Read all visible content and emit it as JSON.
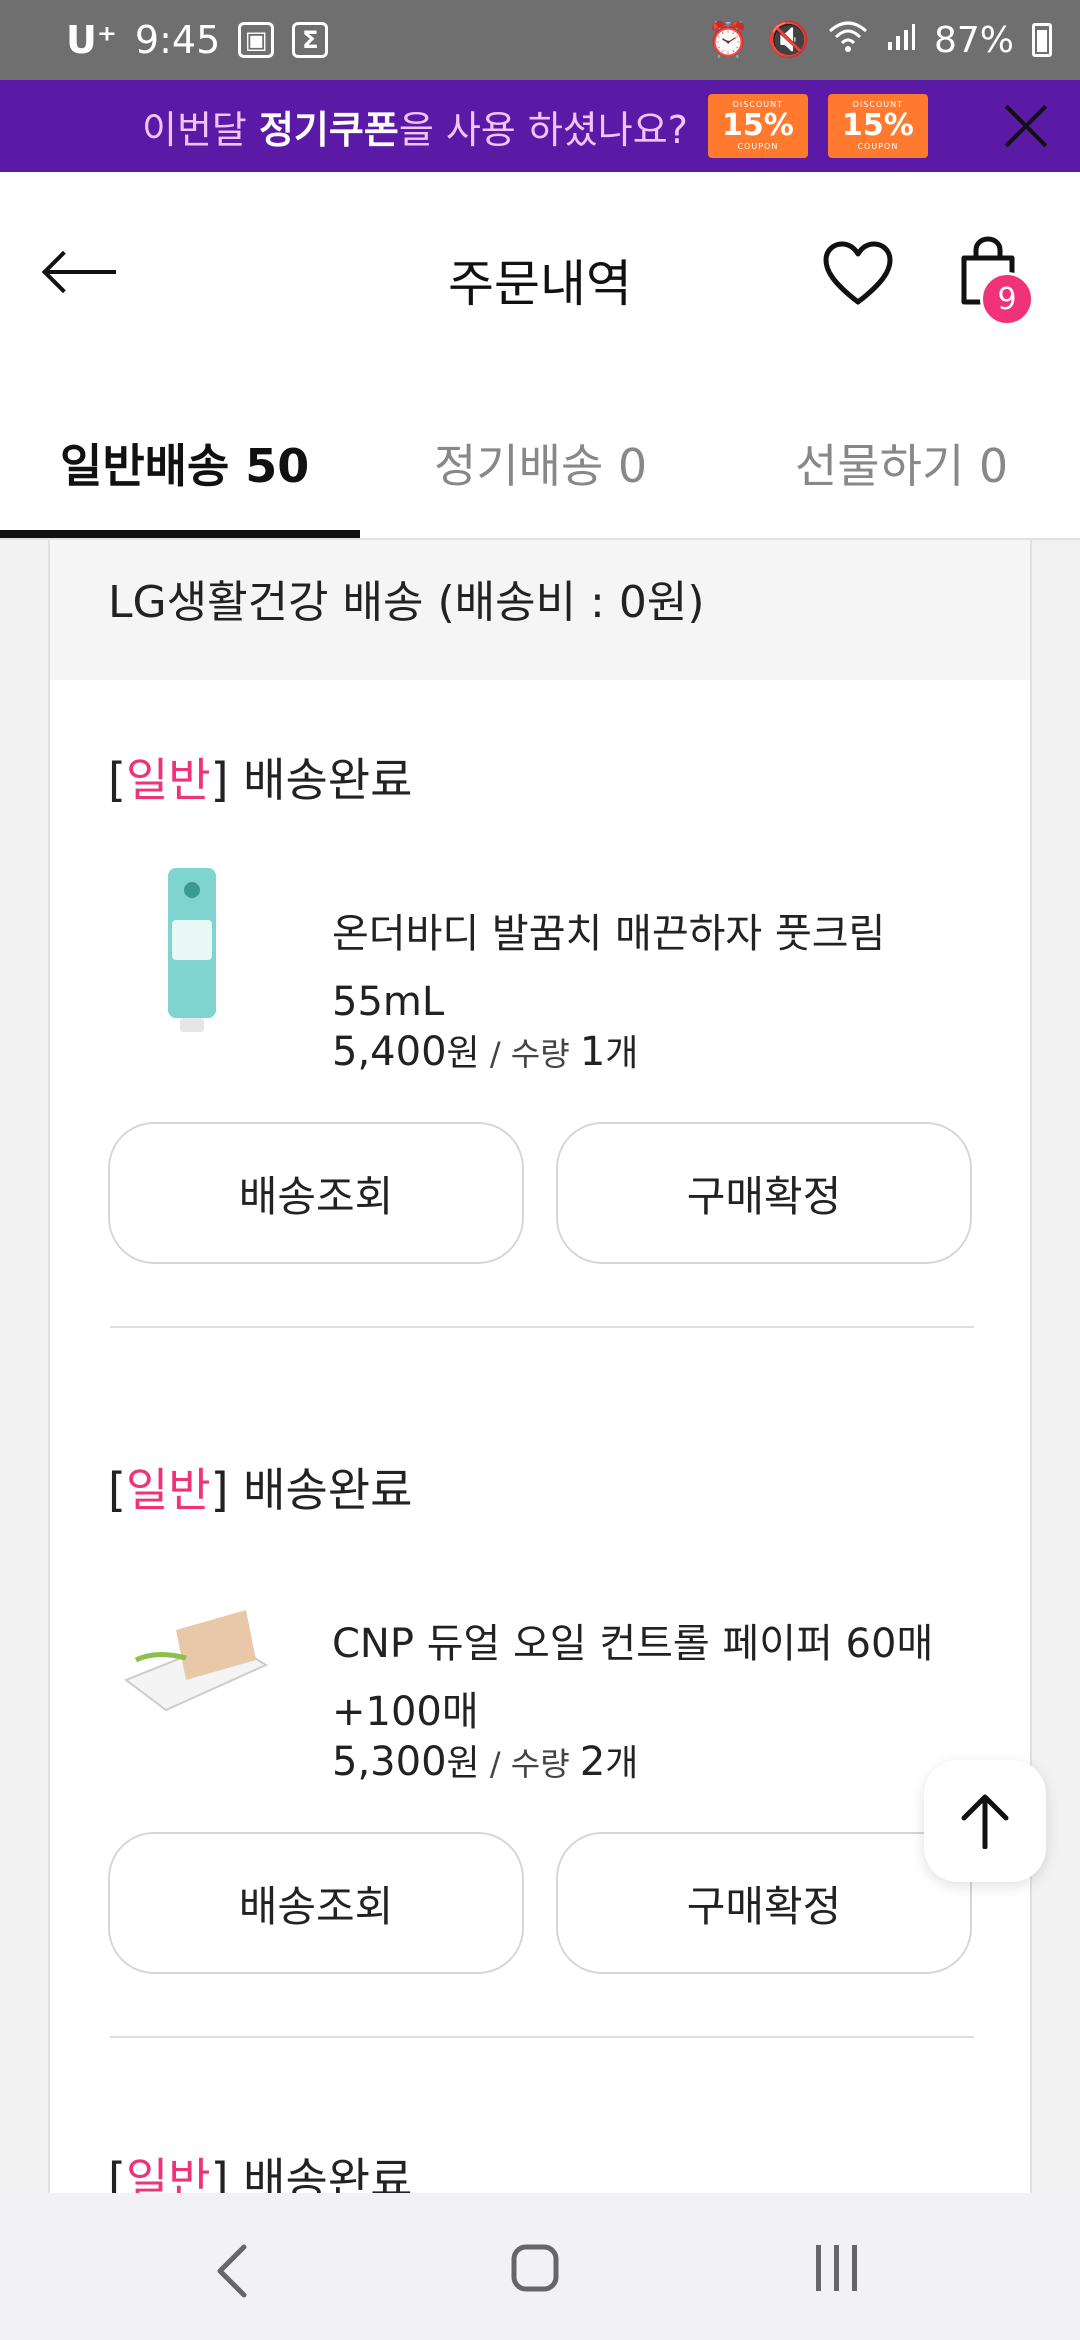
{
  "status_bar": {
    "carrier": "U⁺",
    "time": "9:45",
    "battery": "87%"
  },
  "promo": {
    "text_prefix": "이번달 ",
    "text_bold": "정기쿠폰",
    "text_suffix": "을 사용 하셨나요?",
    "coupons": [
      {
        "top": "DISCOUNT",
        "value": "15%",
        "bottom": "COUPON"
      },
      {
        "top": "DISCOUNT",
        "value": "15%",
        "bottom": "COUPON"
      }
    ],
    "accent": "#5b1aa6"
  },
  "header": {
    "title": "주문내역",
    "cart_count": "9"
  },
  "tabs": [
    {
      "label": "일반배송 50",
      "active": true
    },
    {
      "label": "정기배송 0",
      "active": false
    },
    {
      "label": "선물하기 0",
      "active": false
    }
  ],
  "shipment": {
    "seller_line": "LG생활건강 배송 (배송비 : 0원)"
  },
  "orders": [
    {
      "bracket_open": "[",
      "type": "일반",
      "bracket_close": "]",
      "status": " 배송완료",
      "name_line1": "온더바디 발꿈치 매끈하자 풋크림",
      "name_line2": "55mL",
      "price": "5,400",
      "price_unit": "원",
      "qty_sep": " / 수량 ",
      "qty": "1",
      "qty_unit": "개",
      "btn_track": "배송조회",
      "btn_confirm": "구매확정"
    },
    {
      "bracket_open": "[",
      "type": "일반",
      "bracket_close": "]",
      "status": " 배송완료",
      "name_line1": "CNP 듀얼 오일 컨트롤 페이퍼 60매",
      "name_line2": "+100매",
      "price": "5,300",
      "price_unit": "원",
      "qty_sep": " / 수량 ",
      "qty": "2",
      "qty_unit": "개",
      "btn_track": "배송조회",
      "btn_confirm": "구매확정"
    },
    {
      "bracket_open": "[",
      "type": "일반",
      "bracket_close": "]",
      "status": " 배송완료"
    }
  ],
  "colors": {
    "accent_pink": "#f03379",
    "banner_purple": "#5b1aa6",
    "coupon_orange": "#ff7a2f"
  }
}
